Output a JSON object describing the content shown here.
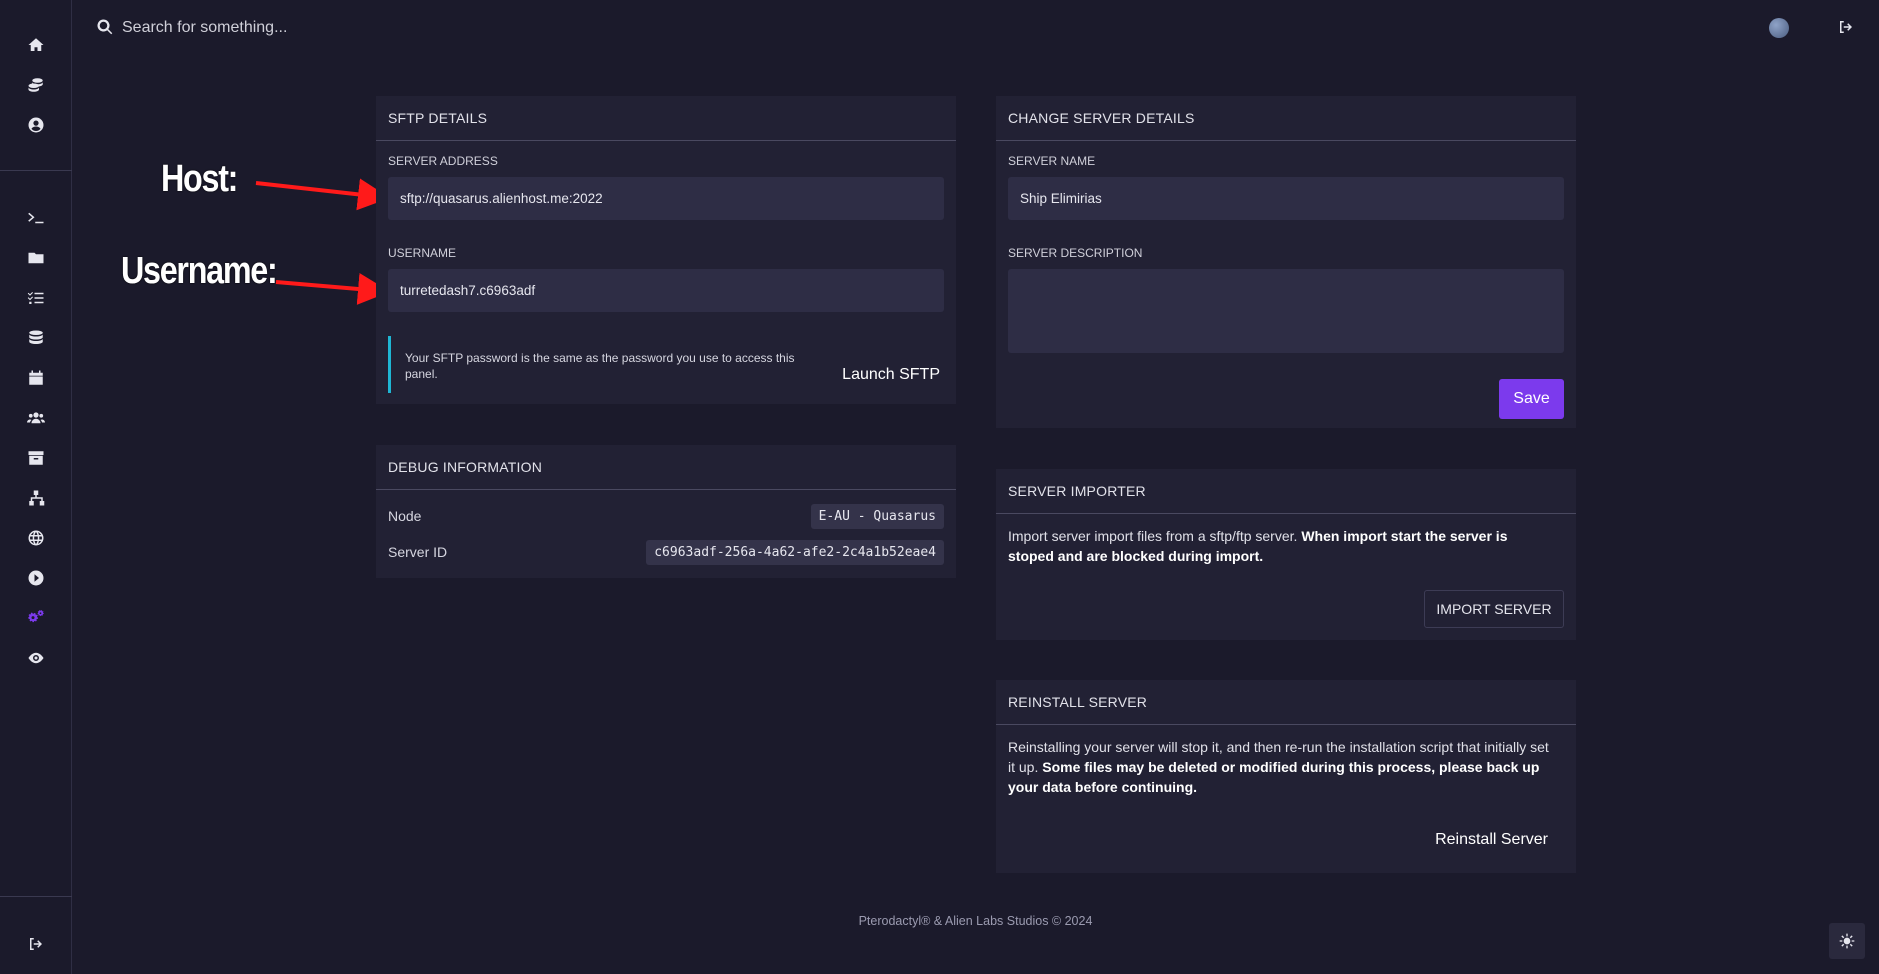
{
  "search": {
    "placeholder": "Search for something..."
  },
  "sidebar": {
    "icons": [
      "home-icon",
      "coins-icon",
      "user-circle-icon",
      "terminal-icon",
      "folder-icon",
      "tasks-icon",
      "database-icon",
      "calendar-icon",
      "users-icon",
      "archive-icon",
      "network-icon",
      "globe-icon",
      "play-icon",
      "settings-gears-icon",
      "eye-icon",
      "logout-icon"
    ],
    "active": "settings-gears-icon"
  },
  "annotations": {
    "host": "Host:",
    "username": "Username:"
  },
  "sftp": {
    "title": "SFTP DETAILS",
    "address_label": "SERVER ADDRESS",
    "address_value": "sftp://quasarus.alienhost.me:2022",
    "username_label": "USERNAME",
    "username_value": "turretedash7.c6963adf",
    "info": "Your SFTP password is the same as the password you use to access this panel.",
    "launch_label": "Launch SFTP"
  },
  "debug": {
    "title": "DEBUG INFORMATION",
    "node_label": "Node",
    "node_value": "E-AU - Quasarus",
    "server_id_label": "Server ID",
    "server_id_value": "c6963adf-256a-4a62-afe2-2c4a1b52eae4"
  },
  "change": {
    "title": "CHANGE SERVER DETAILS",
    "name_label": "SERVER NAME",
    "name_value": "Ship Elimirias",
    "desc_label": "SERVER DESCRIPTION",
    "desc_value": "",
    "save_label": "Save"
  },
  "importer": {
    "title": "SERVER IMPORTER",
    "text_plain": "Import server import files from a sftp/ftp server. ",
    "text_bold": "When import start the server is stoped and are blocked during import.",
    "button_label": "IMPORT SERVER"
  },
  "reinstall": {
    "title": "REINSTALL SERVER",
    "text_plain": "Reinstalling your server will stop it, and then re-run the installation script that initially set it up. ",
    "text_bold": "Some files may be deleted or modified during this process, please back up your data before continuing.",
    "button_label": "Reinstall Server"
  },
  "footer": {
    "text": "Pterodactyl® & Alien Labs Studios © 2024"
  },
  "colors": {
    "accent": "#7c3aed",
    "info_border": "#1fb6d4",
    "background": "#1b1a2b",
    "card": "#222134"
  }
}
